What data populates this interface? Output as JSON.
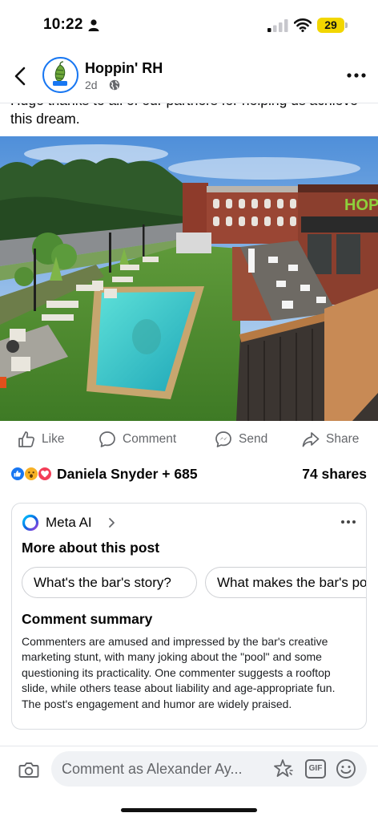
{
  "status_bar": {
    "time": "10:22",
    "battery": "29"
  },
  "post": {
    "page_name": "Hoppin' RH",
    "time_ago": "2d",
    "caption": "Huge thanks to all of our partners for helping us achieve this dream.",
    "photo_sign": "HOPPIN"
  },
  "actions": {
    "like": "Like",
    "comment": "Comment",
    "send": "Send",
    "share": "Share"
  },
  "reactions": {
    "count_text": "Daniela Snyder + 685",
    "shares_text": "74 shares"
  },
  "meta_ai": {
    "name": "Meta AI",
    "heading": "More about this post",
    "suggestions": [
      "What's the bar's story?",
      "What makes the bar's pool unique?"
    ],
    "summary_heading": "Comment summary",
    "summary": "Commenters are amused and impressed by the bar's creative marketing stunt, with many joking about the \"pool\" and some questioning its practicality. One commenter suggests a rooftop slide, while others tease about liability and age-appropriate fun. The post's engagement and humor are widely praised."
  },
  "composer": {
    "placeholder": "Comment as Alexander Ay...",
    "gif_label": "GIF"
  },
  "colors": {
    "brand_blue": "#1877f2",
    "like_blue": "#1877f2",
    "love_red": "#f33e58",
    "haha_yellow": "#f7b125",
    "battery_yellow": "#f2d600",
    "meta_ai_gradient": [
      "#0668e1",
      "#a33bdb",
      "#00c6ff"
    ]
  },
  "icons": [
    "person-icon",
    "signal-icon",
    "wifi-icon",
    "back-icon",
    "globe-icon",
    "more-icon",
    "like-icon",
    "comment-icon",
    "send-icon",
    "share-icon",
    "meta-ai-logo",
    "chevron-right-icon",
    "camera-icon",
    "sparkle-sticker-icon",
    "gif-icon",
    "emoji-icon"
  ]
}
